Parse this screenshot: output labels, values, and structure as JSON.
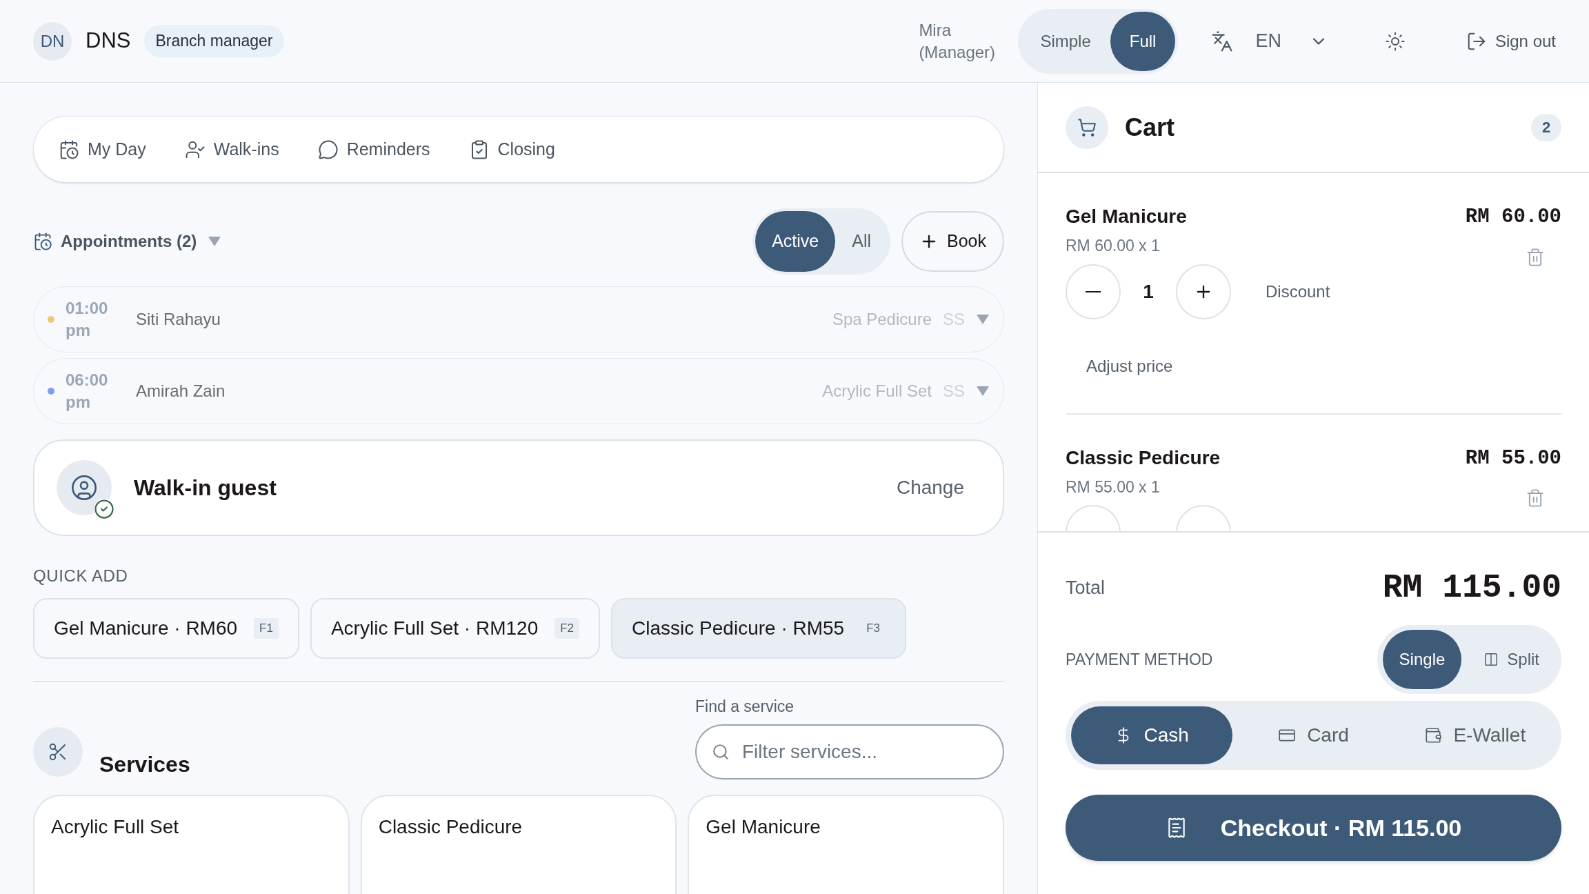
{
  "header": {
    "avatar": "DN",
    "brand": "DNS",
    "role_badge": "Branch manager",
    "user": "Mira (Manager)",
    "mode_toggle": [
      {
        "label": "Simple",
        "selected": false
      },
      {
        "label": "Full",
        "selected": true
      }
    ],
    "language": "EN",
    "sign_out": "Sign out"
  },
  "nav_tabs": [
    {
      "label": "My Day"
    },
    {
      "label": "Walk-ins"
    },
    {
      "label": "Reminders"
    },
    {
      "label": "Closing"
    }
  ],
  "appointments": {
    "title": "Appointments (2)",
    "filter": [
      {
        "label": "Active",
        "selected": true
      },
      {
        "label": "All",
        "selected": false
      }
    ],
    "book": "Book",
    "items": [
      {
        "time": "01:00 pm",
        "name": "Siti Rahayu",
        "service": "Spa Pedicure",
        "staff": "SS",
        "color": "#f5c577"
      },
      {
        "time": "06:00 pm",
        "name": "Amirah Zain",
        "service": "Acrylic Full Set",
        "staff": "SS",
        "color": "#7b9ff2"
      }
    ]
  },
  "customer": {
    "name": "Walk-in guest",
    "action": "Change"
  },
  "quick_add": {
    "title": "QUICK ADD",
    "items": [
      {
        "label": "Gel Manicure · RM60",
        "key": "F1",
        "selected": false
      },
      {
        "label": "Acrylic Full Set · RM120",
        "key": "F2",
        "selected": false
      },
      {
        "label": "Classic Pedicure · RM55",
        "key": "F3",
        "selected": true
      }
    ]
  },
  "services": {
    "title": "Services",
    "search_label": "Find a service",
    "placeholder": "Filter services...",
    "items": [
      {
        "name": "Acrylic Full Set"
      },
      {
        "name": "Classic Pedicure"
      },
      {
        "name": "Gel Manicure"
      }
    ]
  },
  "cart": {
    "title": "Cart",
    "count": "2",
    "items": [
      {
        "name": "Gel Manicure",
        "unit": "RM 60.00 x 1",
        "total": "RM 60.00",
        "qty": "1",
        "discount": "Discount",
        "adjust": "Adjust price"
      },
      {
        "name": "Classic Pedicure",
        "unit": "RM 55.00 x 1",
        "total": "RM 55.00"
      }
    ],
    "total_label": "Total",
    "total": "RM 115.00",
    "payment_label": "PAYMENT METHOD",
    "payment_mode": [
      {
        "label": "Single",
        "selected": true
      },
      {
        "label": "Split",
        "selected": false
      }
    ],
    "methods": [
      {
        "label": "Cash",
        "selected": true
      },
      {
        "label": "Card",
        "selected": false
      },
      {
        "label": "E-Wallet",
        "selected": false
      }
    ],
    "checkout": "Checkout · RM 115.00"
  }
}
